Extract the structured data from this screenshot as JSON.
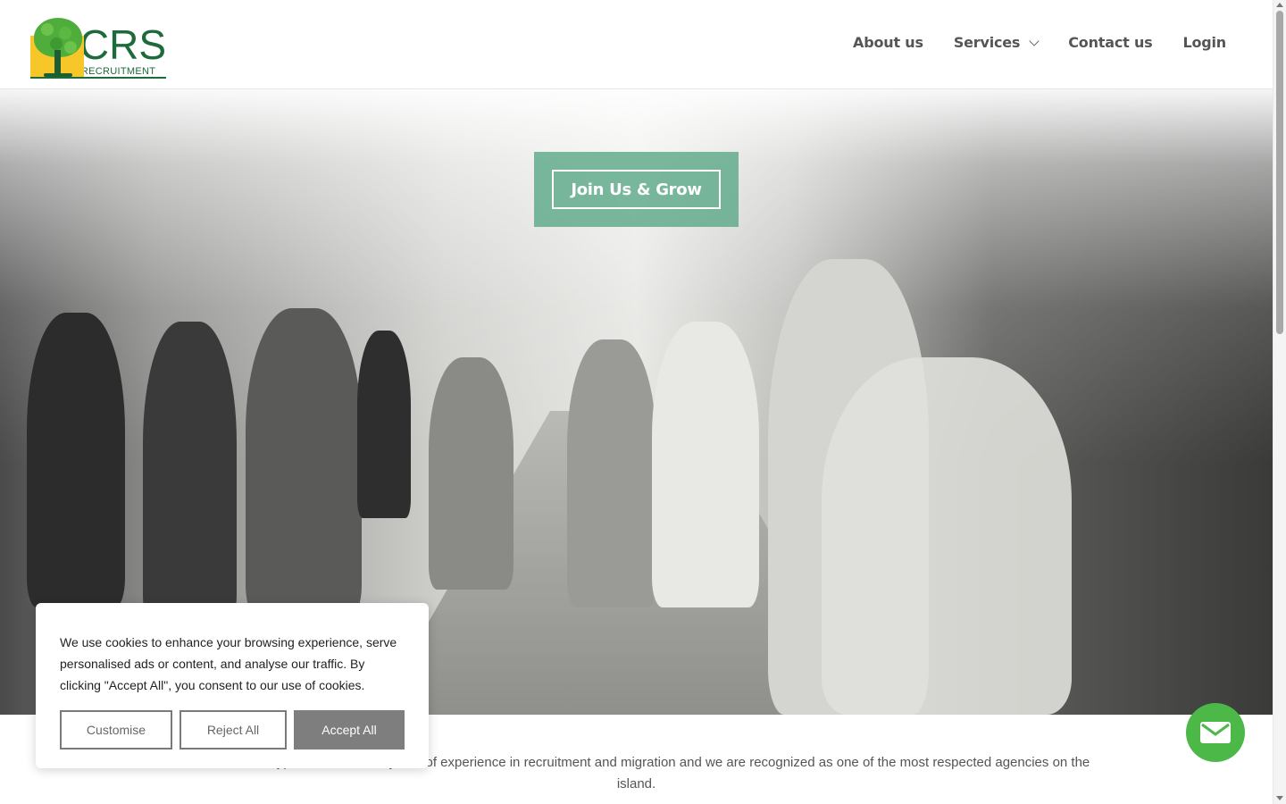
{
  "brand": {
    "name": "CRS",
    "tagline": "RECRUITMENT",
    "colors": {
      "green": "#1d6a3a",
      "leaf": "#4fae3b",
      "yellow": "#f7c72a"
    }
  },
  "nav": {
    "items": [
      {
        "label": "About us",
        "dropdown": false
      },
      {
        "label": "Services",
        "dropdown": true
      },
      {
        "label": "Contact us",
        "dropdown": false
      },
      {
        "label": "Login",
        "dropdown": false
      }
    ]
  },
  "hero": {
    "cta_label": "Join Us & Grow",
    "cta_color": "#5eaa8a"
  },
  "intro": {
    "text": "ed in Nicosia, Cyprus with over 20 years of experience in recruitment and migration and we are recognized as one of the most respected agencies on the island."
  },
  "cookie": {
    "message": "We use cookies to enhance your browsing experience, serve personalised ads or content, and analyse our traffic. By clicking \"Accept All\", you consent to our use of cookies.",
    "customise_label": "Customise",
    "reject_label": "Reject All",
    "accept_label": "Accept All"
  },
  "fab": {
    "icon": "envelope-icon",
    "color": "#4cb848"
  }
}
